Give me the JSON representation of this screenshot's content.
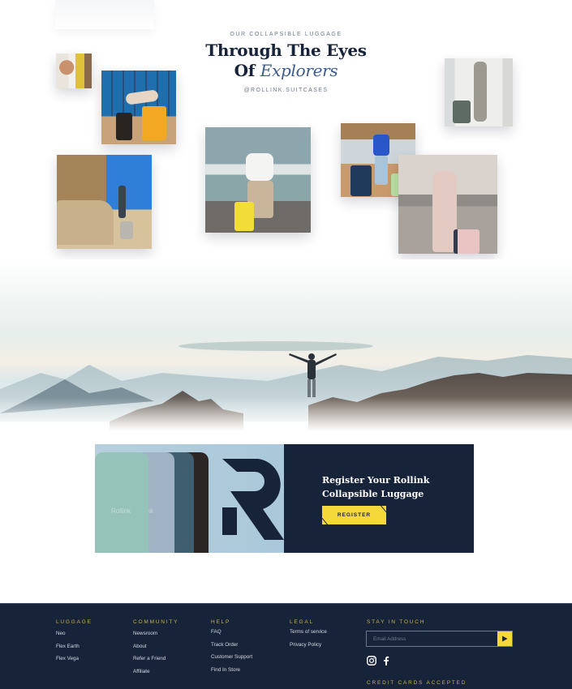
{
  "gallery": {
    "eyebrow": "OUR COLLAPSIBLE LUGGAGE",
    "title_line1": "Through The Eyes",
    "title_line2_plain": "Of ",
    "title_line2_italic": "Explorers",
    "handle": "@ROLLINK.SUITCASES",
    "photos": [
      {
        "alt": "Man taking selfie with yellow luggage"
      },
      {
        "alt": "Woman posing on yellow suitcase at airport departures board"
      },
      {
        "alt": "Woman taking mirror selfie with green suitcase"
      },
      {
        "alt": "Traveler with suitcase at stone ruins"
      },
      {
        "alt": "Woman seated with yellow suitcase at airport"
      },
      {
        "alt": "Man in blue with navy and green suitcases at airport"
      },
      {
        "alt": "Woman in pink dress with pink suitcase on terrace"
      }
    ]
  },
  "hero": {
    "alt": "Person with arms outstretched on mountain peak above clouds"
  },
  "banner": {
    "bag_brand": "Rollink",
    "title_line1": "Register Your Rollink",
    "title_line2": "Collapsible Luggage",
    "button_label": "REGISTER",
    "colors": {
      "navy": "#172339",
      "yellow": "#f5d93a"
    }
  },
  "footer": {
    "columns": [
      {
        "heading": "LUGGAGE",
        "links": [
          "Neo",
          "Flex Earth",
          "Flex Vega"
        ]
      },
      {
        "heading": "COMMUNITY",
        "links": [
          "Newsroom",
          "About",
          "Refer a Friend",
          "Affiliate"
        ]
      },
      {
        "heading": "HELP",
        "links": [
          "FAQ",
          "Track Order",
          "Customer Support",
          "Find In Store"
        ]
      },
      {
        "heading": "LEGAL",
        "links": [
          "Terms of service",
          "Privacy Policy"
        ]
      }
    ],
    "stay_in_touch": {
      "heading": "STAY IN TOUCH",
      "email_placeholder": "Email Address",
      "email_value": "",
      "submit_icon": "play-arrow-icon",
      "social": [
        "instagram-icon",
        "facebook-icon"
      ]
    },
    "cards_heading": "CREDIT CARDS ACCEPTED"
  }
}
